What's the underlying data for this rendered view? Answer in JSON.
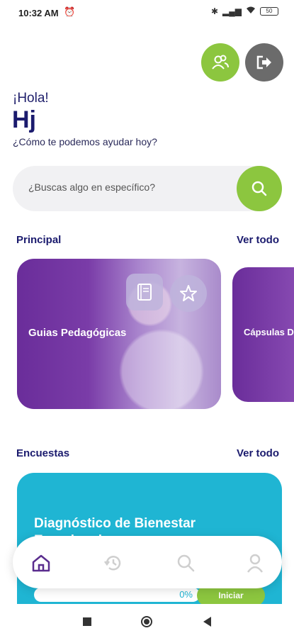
{
  "status_bar": {
    "time": "10:32 AM",
    "battery": "50"
  },
  "greeting": {
    "hello": "¡Hola!",
    "name": "Hj",
    "subtitle": "¿Cómo te podemos ayudar hoy?"
  },
  "search": {
    "placeholder": "¿Buscas algo en específico?"
  },
  "sections": {
    "principal": {
      "title": "Principal",
      "see_all": "Ver todo"
    },
    "encuestas": {
      "title": "Encuestas",
      "see_all": "Ver todo"
    }
  },
  "cards": {
    "guides": {
      "title": "Guias Pedagógicas"
    },
    "capsulas": {
      "title": "Cápsulas D"
    },
    "survey": {
      "title": "Diagnóstico de Bienestar Emocional",
      "progress_label": "0%",
      "progress": 0,
      "start_label": "Iniciar"
    }
  },
  "icons": {
    "users": "users-icon",
    "logout": "logout-icon",
    "search": "search-icon",
    "book": "book-icon",
    "star": "star-icon",
    "nav_home": "home-icon",
    "nav_history": "history-icon",
    "nav_search": "search-icon",
    "nav_profile": "profile-icon"
  },
  "colors": {
    "accent_green": "#8cc63f",
    "brand_navy": "#1b1b6e",
    "purple_card": "#6a2d9a",
    "survey_cyan": "#1fb5d3"
  }
}
